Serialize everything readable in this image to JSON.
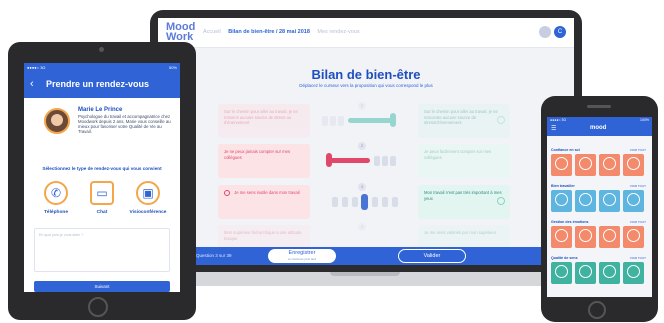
{
  "laptop": {
    "logo_line1": "Mood",
    "logo_line2": "Work",
    "nav": [
      "Accueil",
      "Bilan de bien-être / 28 mai 2018",
      "Mes rendez-vous"
    ],
    "title": "Bilan de bien-être",
    "subtitle": "Déplacez le curseur vers la proposition qui vous correspond le plus",
    "rows": [
      {
        "left": "Sur le chemin pour aller au travail, je ne ressens aucune source de stress ou d'énervement",
        "right": "Sur le chemin pour aller au travail, je ne rencontre aucune source de stress/d'énervement",
        "value": 2,
        "color": "#2bb3a0"
      },
      {
        "left": "Je ne peux jamais compter sur mes collègues",
        "right": "Je peux facilement compter sur mes collègues",
        "value": 2,
        "color": "#e0486a"
      },
      {
        "left": "Je me sens inutile dans mon travail",
        "right": "Mon travail n'est pas très important à mes yeux",
        "value": 3,
        "color": "#4a73d6"
      },
      {
        "left": "Mon supérieur hiérarchique a une attitude toxique",
        "right": "Je me sens valorisé par mon supérieur",
        "value": 3,
        "color": "#4a73d6"
      }
    ],
    "question_counter": "Question 3 sur 39",
    "save_label": "Enregistrer",
    "save_sub": "et continuer plus tard",
    "validate_label": "Valider",
    "avatar_letter": "C",
    "colors": {
      "primary": "#2f63d6",
      "teal": "#2bb3a0",
      "pink": "#e0486a"
    }
  },
  "tablet": {
    "status_left": "●●●●○ 3G",
    "status_right": "50%",
    "header_title": "Prendre un rendez-vous",
    "coach_name": "Marie Le Prince",
    "coach_desc": "Psychologue du travail et accompagnatrice chez Moodwork depuis 2 ans, Marie vous conseille au mieux pour favoriser votre Qualité de Vie au Travail.",
    "type_label": "Sélectionnez le type de rendez-vous qui vous convient",
    "options": [
      {
        "label": "Téléphone",
        "icon": "phone-icon"
      },
      {
        "label": "Chat",
        "icon": "chat-icon"
      },
      {
        "label": "Visioconférence",
        "icon": "video-icon"
      }
    ],
    "textarea_placeholder": "En quoi puis-je vous aider ?",
    "submit_label": "Suivant"
  },
  "phone": {
    "status_left": "●●●●○ 3G",
    "status_right": "100%",
    "logo": "mood",
    "sections": [
      {
        "title": "Confiance en soi",
        "more": "VOIR TOUT",
        "color": "#f28a6b"
      },
      {
        "title": "Bien travailler",
        "more": "VOIR TOUT",
        "color": "#5eb5e0"
      },
      {
        "title": "Gestion des émotions",
        "more": "VOIR TOUT",
        "color": "#f28a6b"
      },
      {
        "title": "Qualité de sens",
        "more": "VOIR TOUT",
        "color": "#3fb39f"
      }
    ]
  }
}
